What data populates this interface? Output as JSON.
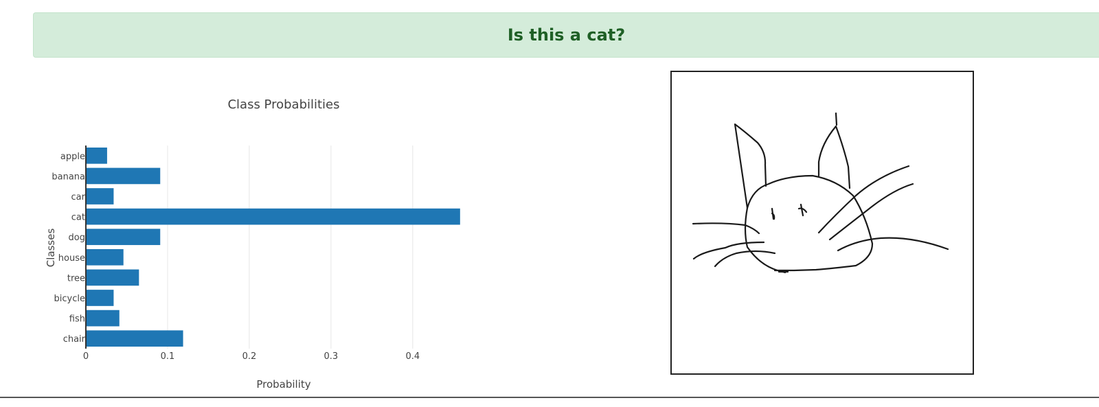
{
  "banner": {
    "text": "Is this a cat?"
  },
  "colors": {
    "banner_bg": "#d4ecda",
    "banner_text": "#1f6026",
    "bar": "#1f77b4"
  },
  "chart_data": {
    "type": "bar",
    "orientation": "horizontal",
    "title": "Class Probabilities",
    "xlabel": "Probability",
    "ylabel": "Classes",
    "categories": [
      "apple",
      "banana",
      "car",
      "cat",
      "dog",
      "house",
      "tree",
      "bicycle",
      "fish",
      "chair"
    ],
    "values": [
      0.026,
      0.091,
      0.034,
      0.458,
      0.091,
      0.046,
      0.065,
      0.034,
      0.041,
      0.119
    ],
    "xticks": [
      0,
      0.1,
      0.2,
      0.3,
      0.4
    ],
    "xtick_labels": [
      "0",
      "0.1",
      "0.2",
      "0.3",
      "0.4"
    ],
    "xlim": [
      0,
      0.48
    ],
    "grid": true,
    "legend": false
  },
  "drawing_canvas": {
    "content": "hand-drawn cat sketch",
    "icon": "cat-sketch-icon"
  }
}
